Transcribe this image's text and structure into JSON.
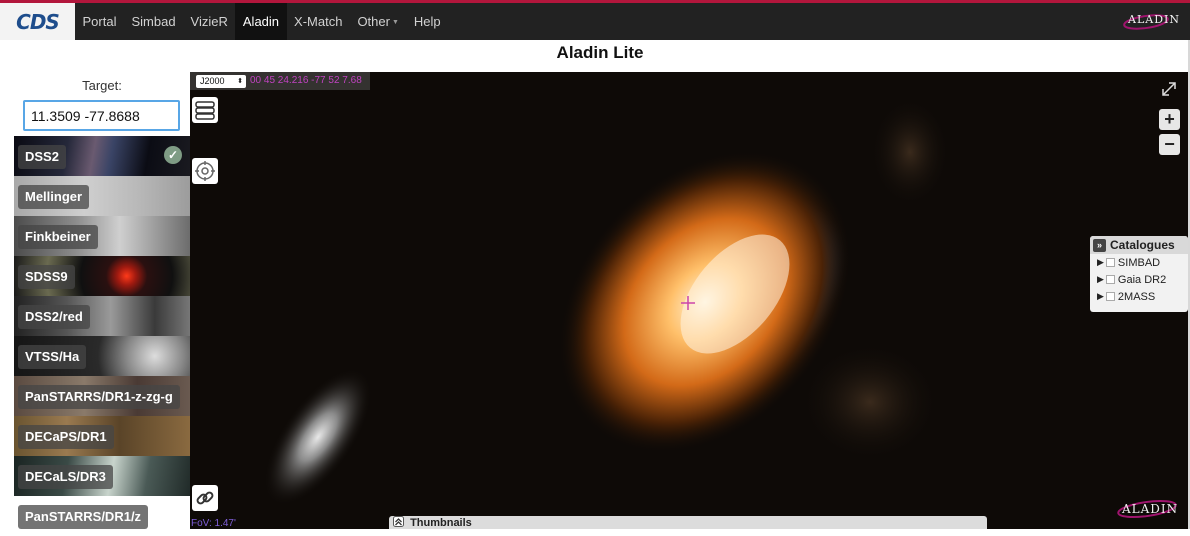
{
  "nav": {
    "logo": "CDS",
    "items": [
      {
        "label": "Portal",
        "active": false
      },
      {
        "label": "Simbad",
        "active": false
      },
      {
        "label": "VizieR",
        "active": false
      },
      {
        "label": "Aladin",
        "active": true
      },
      {
        "label": "X-Match",
        "active": false
      },
      {
        "label": "Other",
        "active": false,
        "dropdown": true
      },
      {
        "label": "Help",
        "active": false
      }
    ],
    "brand_right": "ALADIN"
  },
  "page_title": "Aladin Lite",
  "left_panel": {
    "target_label": "Target:",
    "target_value": "11.3509 -77.8688",
    "surveys": [
      {
        "label": "DSS2",
        "selected": true
      },
      {
        "label": "Mellinger",
        "selected": false
      },
      {
        "label": "Finkbeiner",
        "selected": false
      },
      {
        "label": "SDSS9",
        "selected": false
      },
      {
        "label": "DSS2/red",
        "selected": false
      },
      {
        "label": "VTSS/Ha",
        "selected": false
      },
      {
        "label": "PanSTARRS/DR1-z-zg-g",
        "selected": false
      },
      {
        "label": "DECaPS/DR1",
        "selected": false
      },
      {
        "label": "DECaLS/DR3",
        "selected": false
      },
      {
        "label": "PanSTARRS/DR1/z",
        "selected": false
      }
    ]
  },
  "sky_view": {
    "frame": "J2000",
    "coordinates": "00 45 24.216 -77 52 7.68",
    "fov": "FoV: 1.47'",
    "thumbnails_label": "Thumbnails",
    "catalogues": {
      "title": "Catalogues",
      "items": [
        "SIMBAD",
        "Gaia DR2",
        "2MASS"
      ]
    },
    "zoom_in": "+",
    "zoom_out": "−",
    "logo_text": "ALADIN"
  },
  "colors": {
    "nav_bg": "#222222",
    "nav_accent": "#b2163c",
    "input_focus": "#58a6e6",
    "coordinate_text": "#c042c0",
    "reticle": "#cc44aa"
  }
}
